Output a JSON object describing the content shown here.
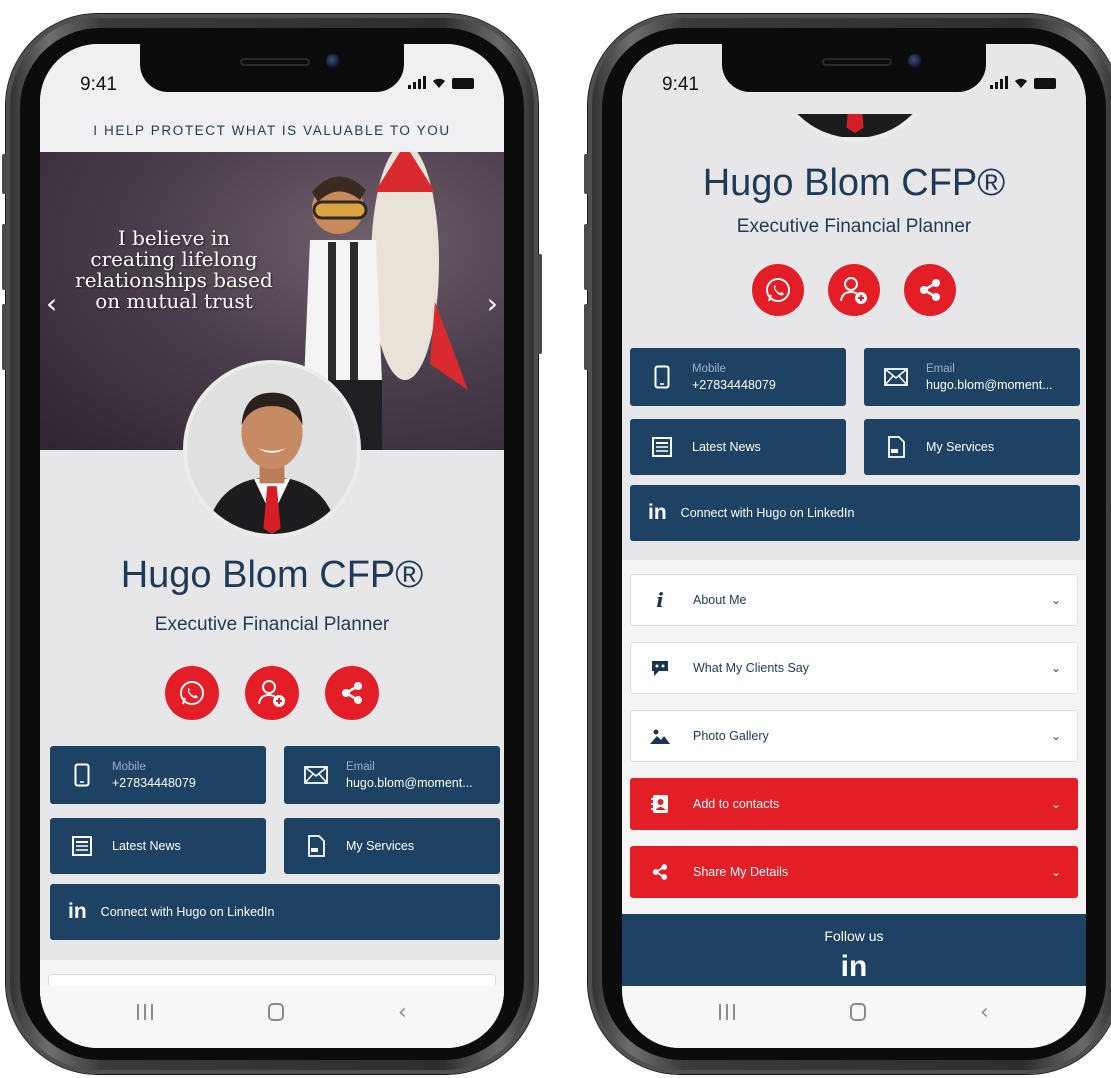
{
  "status": {
    "time": "9:41"
  },
  "profile": {
    "tagline": "I HELP PROTECT WHAT IS VALUABLE TO YOU",
    "hero_quote": "I believe in creating lifelong relationships based on mutual trust",
    "name": "Hugo Blom CFP®",
    "title": "Executive Financial Planner"
  },
  "actions": [
    {
      "icon": "whatsapp-icon",
      "color": "#e41e26"
    },
    {
      "icon": "add-contact-icon",
      "color": "#e41e26"
    },
    {
      "icon": "share-icon",
      "color": "#e41e26"
    }
  ],
  "tiles": {
    "mobile_label": "Mobile",
    "mobile_value": "+27834448079",
    "email_label": "Email",
    "email_value": "hugo.blom@moment...",
    "news": "Latest News",
    "services": "My Services",
    "linkedin": "Connect with Hugo on LinkedIn",
    "linkedin_glyph": "in"
  },
  "accordion": {
    "about": "About Me",
    "clients": "What My Clients Say",
    "gallery": "Photo Gallery",
    "add_contacts": "Add to contacts",
    "share": "Share My Details"
  },
  "footer": {
    "follow": "Follow us",
    "linkedin_glyph": "in"
  },
  "colors": {
    "navy": "#1d4263",
    "red": "#e41e26",
    "text_navy": "#1f3a57"
  }
}
